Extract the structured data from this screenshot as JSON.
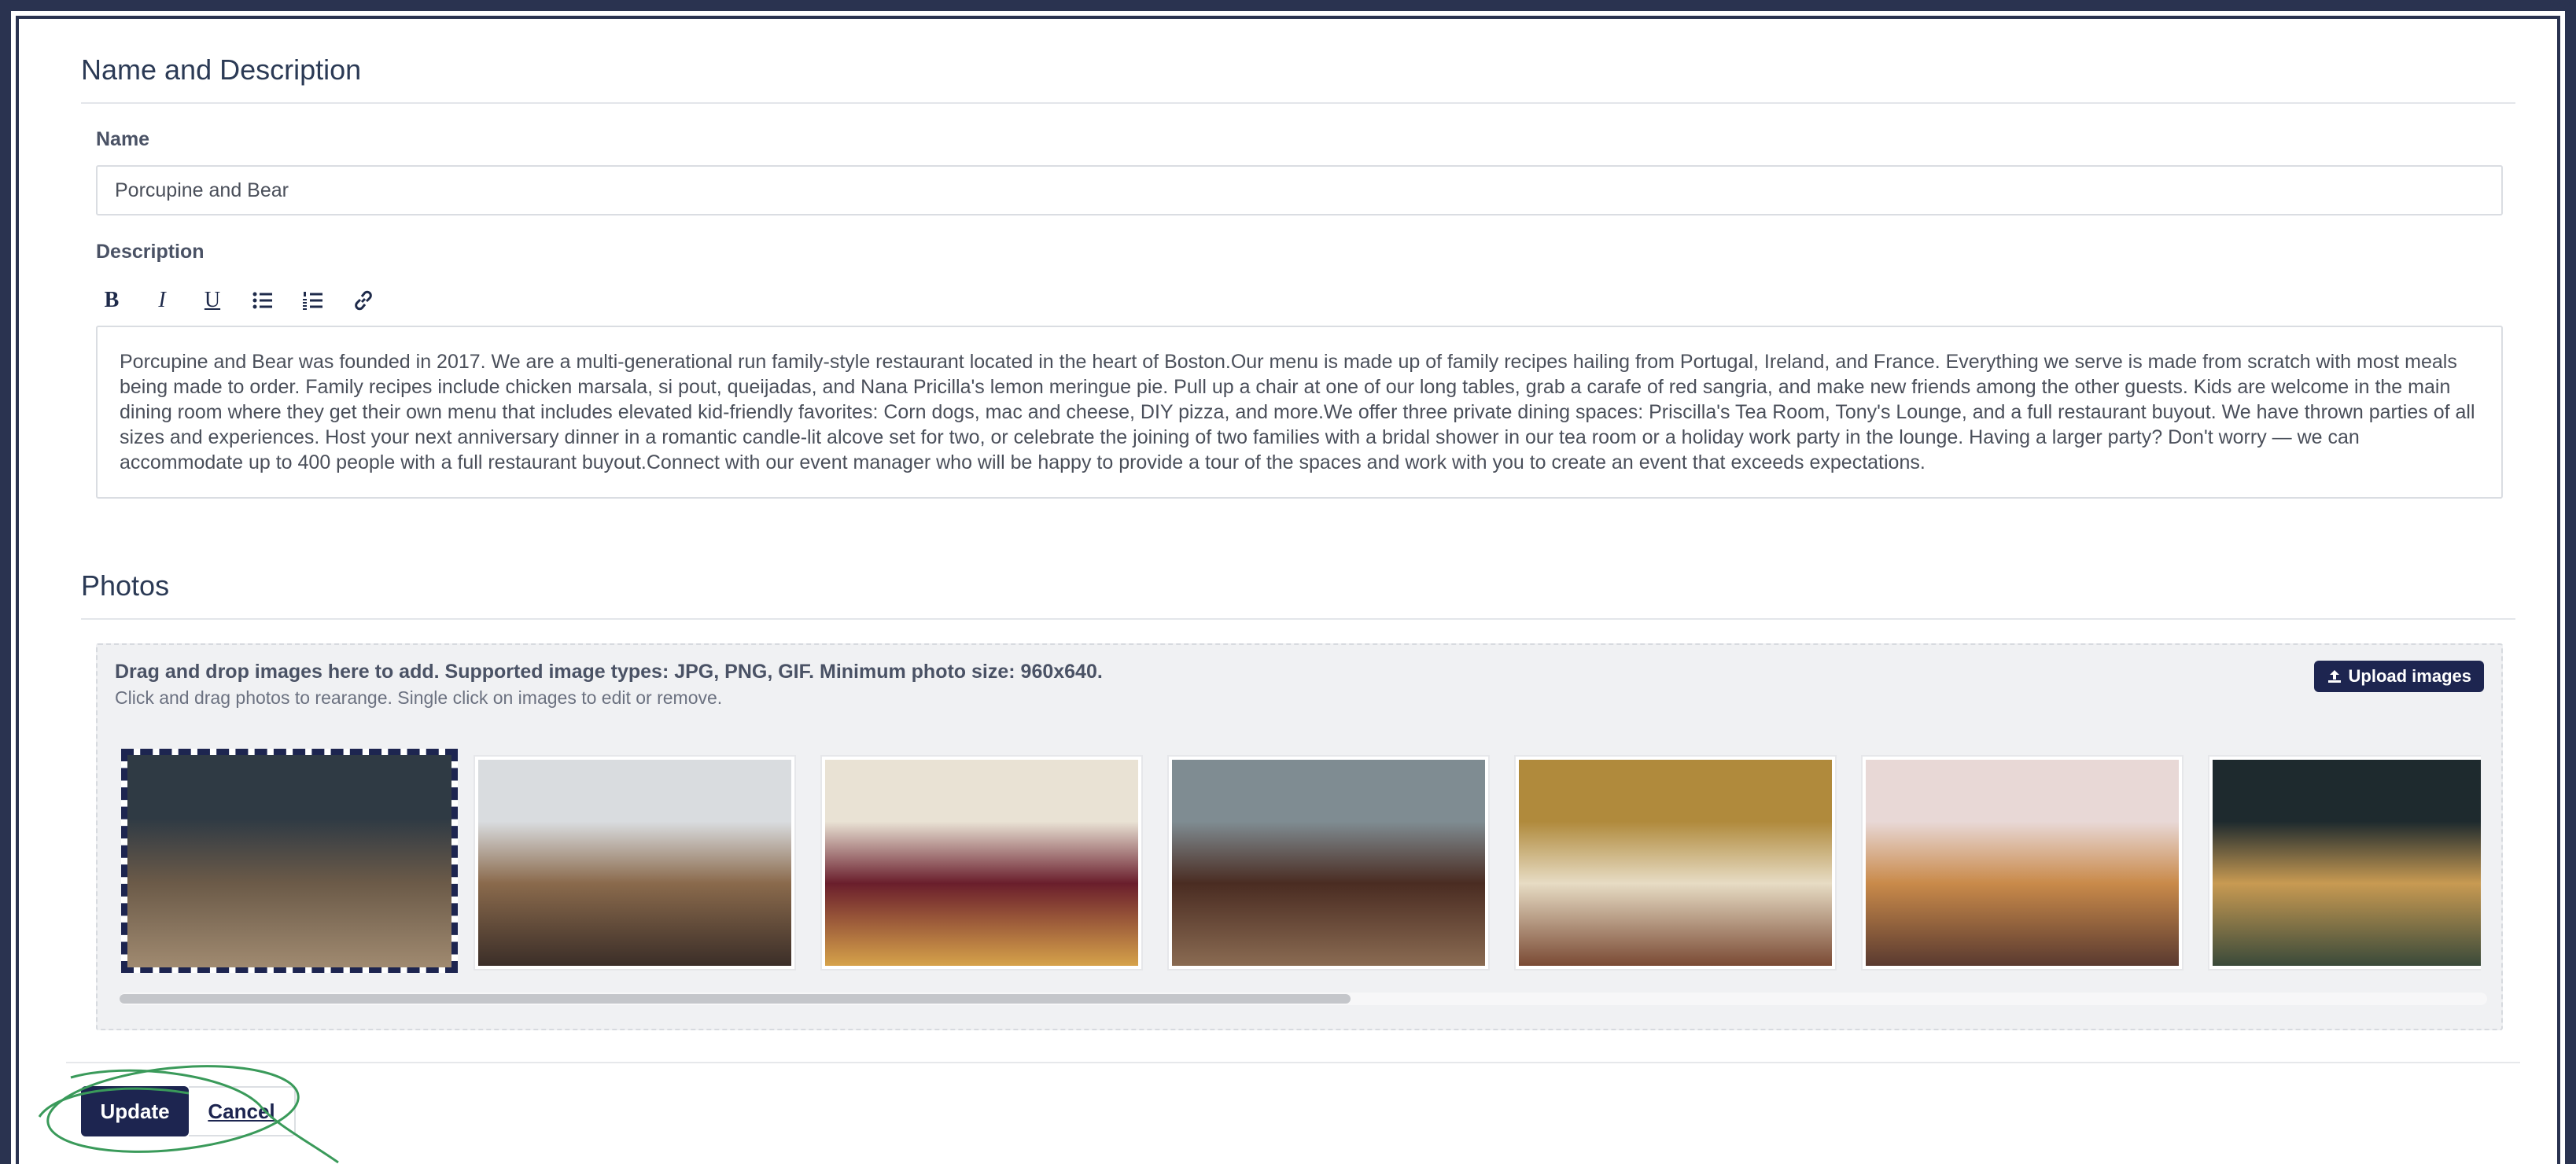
{
  "name_section": {
    "title": "Name and Description",
    "name_label": "Name",
    "name_value": "Porcupine and Bear",
    "description_label": "Description",
    "toolbar": {
      "bold": "B",
      "italic": "I",
      "underline": "U"
    },
    "description_text": "Porcupine and Bear was founded in 2017. We are a multi-generational run family-style restaurant located in the heart of Boston.Our menu is made up of family recipes hailing from Portugal, Ireland, and France. Everything we serve is made from scratch with most meals being made to order. Family recipes include chicken marsala, si pout, queijadas, and Nana Pricilla's lemon meringue pie. Pull up a chair at one of our long tables, grab a carafe of red sangria, and make new friends among the other guests. Kids are welcome in the main dining room where they get their own menu that includes elevated kid-friendly favorites: Corn dogs, mac and cheese, DIY pizza, and more.We offer three private dining spaces: Priscilla's Tea Room, Tony's Lounge, and a full restaurant buyout. We have thrown parties of all sizes and experiences. Host your next anniversary dinner in a romantic candle-lit alcove set for two, or celebrate the joining of two families with a bridal shower in our tea room or a holiday work party in the lounge. Having a larger party? Don't worry — we can accommodate up to 400 people with a full restaurant buyout.Connect with our event manager who will be happy to provide a tour of the spaces and work with you to create an event that exceeds expectations."
  },
  "photos_section": {
    "title": "Photos",
    "dropzone_title": "Drag and drop images here to add. Supported image types: JPG, PNG, GIF. Minimum photo size: 960x640.",
    "dropzone_subtitle": "Click and drag photos to rearange. Single click on images to edit or remove.",
    "upload_label": "Upload images",
    "scroll_position": 0.52,
    "photos": [
      {
        "subject": "cafe interior",
        "selected": true,
        "colors": [
          "#2f3a44",
          "#6b5a48",
          "#a08a70"
        ]
      },
      {
        "subject": "industrial dining room",
        "selected": false,
        "colors": [
          "#d9dcdf",
          "#8a6a4c",
          "#3b2e28"
        ]
      },
      {
        "subject": "charcuterie platter",
        "selected": false,
        "colors": [
          "#e9e2d4",
          "#6a1e2c",
          "#d6a24a"
        ]
      },
      {
        "subject": "leather lounge",
        "selected": false,
        "colors": [
          "#7f8c92",
          "#4a2c22",
          "#8a6b52"
        ]
      },
      {
        "subject": "tea room",
        "selected": false,
        "colors": [
          "#b08a3c",
          "#e7dcc4",
          "#7a4a34"
        ]
      },
      {
        "subject": "pastry stand",
        "selected": false,
        "colors": [
          "#e8d8d6",
          "#c98a4a",
          "#5a3a30"
        ]
      },
      {
        "subject": "restaurant exterior at night",
        "selected": false,
        "colors": [
          "#1e2a2e",
          "#c89a52",
          "#3a4a3a"
        ]
      }
    ]
  },
  "footer": {
    "update_label": "Update",
    "cancel_label": "Cancel"
  },
  "colors": {
    "primary": "#1d2550",
    "frame": "#2a3350",
    "annotation": "#3a9a5a"
  }
}
